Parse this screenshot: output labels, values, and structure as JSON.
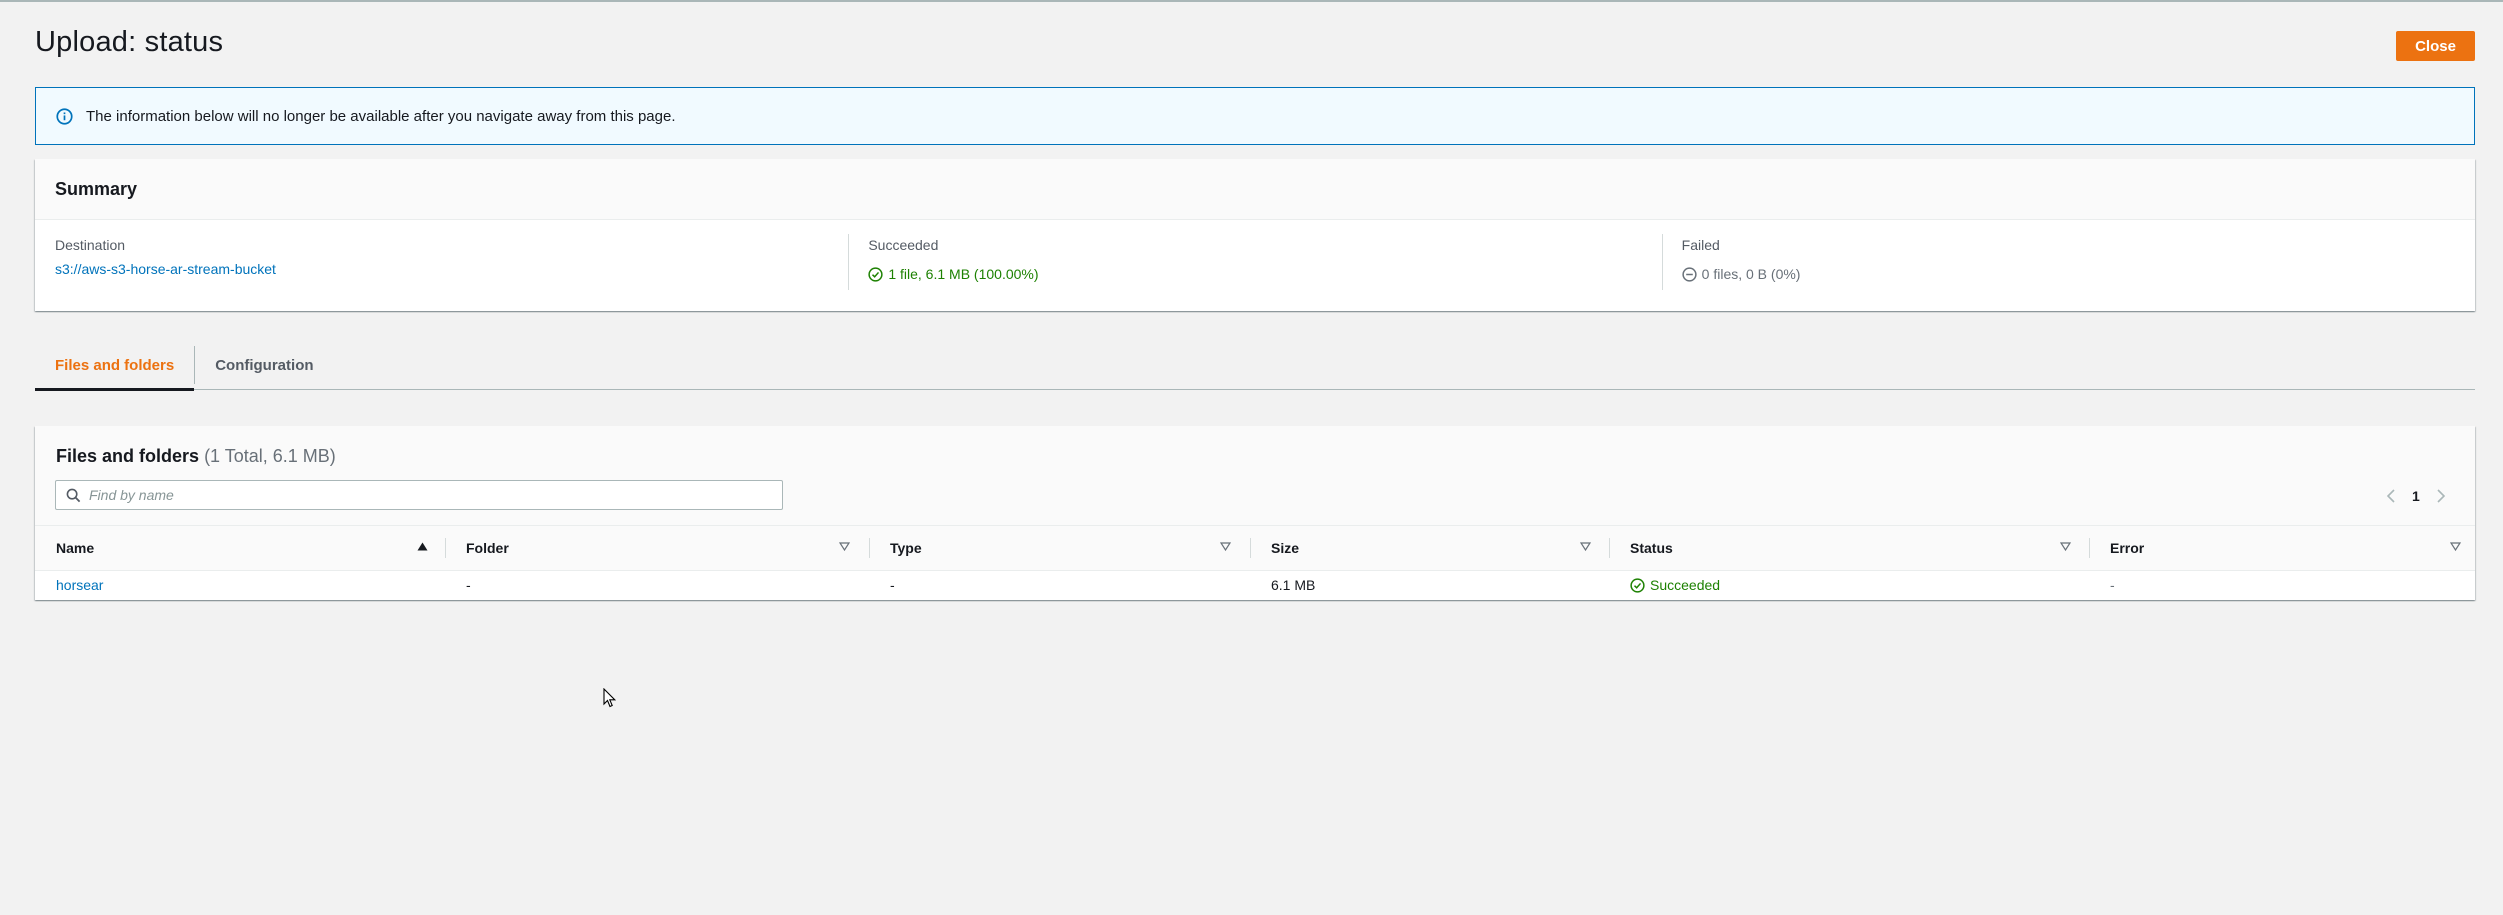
{
  "page": {
    "title": "Upload: status"
  },
  "actions": {
    "close_label": "Close"
  },
  "alert": {
    "icon": "info-icon",
    "message": "The information below will no longer be available after you navigate away from this page."
  },
  "summary": {
    "title": "Summary",
    "destination": {
      "label": "Destination",
      "value": "s3://aws-s3-horse-ar-stream-bucket"
    },
    "succeeded": {
      "label": "Succeeded",
      "value": "1 file, 6.1 MB (100.00%)",
      "icon": "check-circle-icon"
    },
    "failed": {
      "label": "Failed",
      "value": "0 files, 0 B (0%)",
      "icon": "minus-circle-icon"
    }
  },
  "tabs": [
    {
      "label": "Files and folders",
      "active": true
    },
    {
      "label": "Configuration",
      "active": false
    }
  ],
  "files": {
    "title": "Files and folders",
    "count": "(1 Total, 6.1 MB)",
    "search_placeholder": "Find by name",
    "page": "1",
    "columns": [
      "Name",
      "Folder",
      "Type",
      "Size",
      "Status",
      "Error"
    ],
    "rows": [
      {
        "name": "horsear",
        "folder": "-",
        "type": "-",
        "size": "6.1 MB",
        "status": "Succeeded",
        "error": "-"
      }
    ]
  },
  "colors": {
    "accent": "#ec7211",
    "link": "#0073bb",
    "success": "#1d8102",
    "info_border": "#0073bb"
  }
}
